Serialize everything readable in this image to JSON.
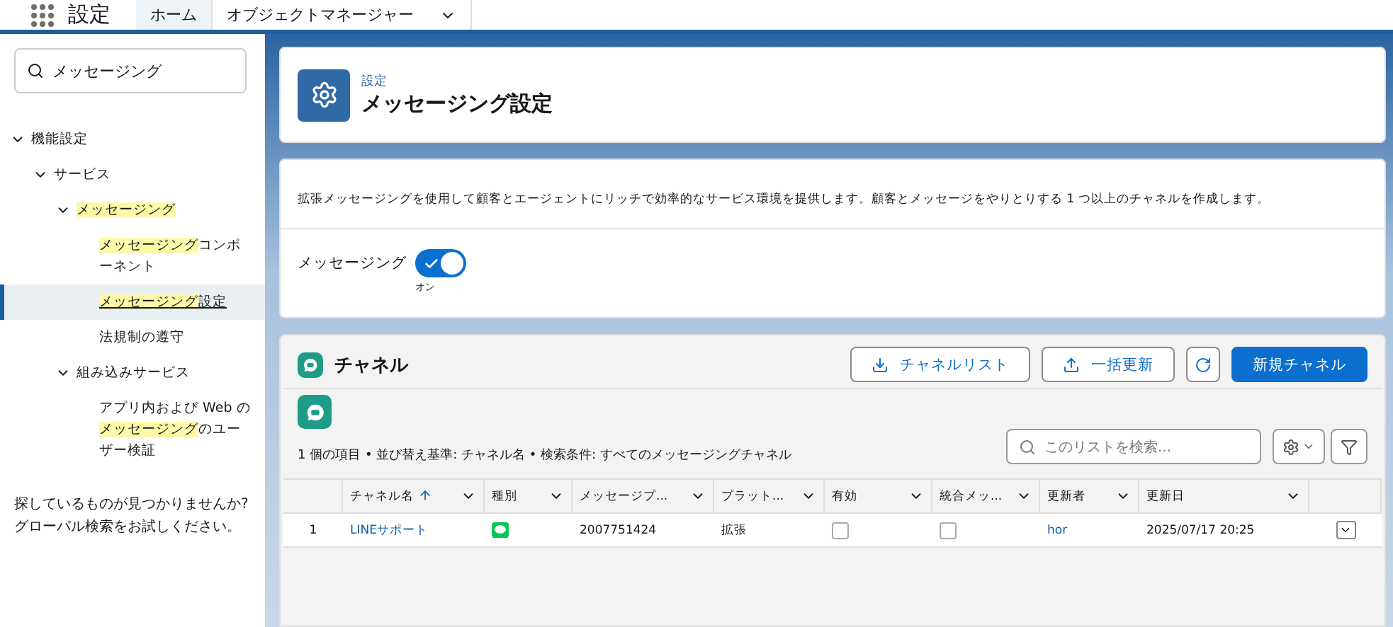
{
  "top_bar": {
    "app_title": "設定",
    "tabs": [
      {
        "label": "ホーム",
        "selected": true,
        "dropdown": false
      },
      {
        "label": "オブジェクトマネージャー",
        "selected": false,
        "dropdown": true
      }
    ]
  },
  "sidebar": {
    "search": {
      "value": "メッセージング"
    },
    "tree": [
      {
        "segments": [
          {
            "text": "機能設定",
            "highlight": false
          }
        ],
        "expanded": true,
        "selected": false,
        "children": [
          {
            "segments": [
              {
                "text": "サービス",
                "highlight": false
              }
            ],
            "expanded": true,
            "selected": false,
            "children": [
              {
                "segments": [
                  {
                    "text": "メッセージング",
                    "highlight": true
                  }
                ],
                "expanded": true,
                "selected": false,
                "children": [
                  {
                    "segments": [
                      {
                        "text": "メッセージング",
                        "highlight": true
                      },
                      {
                        "text": "コンポーネント",
                        "highlight": false
                      }
                    ],
                    "selected": false
                  },
                  {
                    "segments": [
                      {
                        "text": "メッセージング",
                        "highlight": true
                      },
                      {
                        "text": "設定",
                        "highlight": false
                      }
                    ],
                    "selected": true
                  },
                  {
                    "segments": [
                      {
                        "text": "法規制の遵守",
                        "highlight": false
                      }
                    ],
                    "selected": false
                  }
                ]
              },
              {
                "segments": [
                  {
                    "text": "組み込みサービス",
                    "highlight": false
                  }
                ],
                "expanded": true,
                "selected": false,
                "children": [
                  {
                    "segments": [
                      {
                        "text": "アプリ内および Web の",
                        "highlight": false
                      },
                      {
                        "text": "メッセージング",
                        "highlight": true
                      },
                      {
                        "text": "のユーザー検証",
                        "highlight": false
                      }
                    ],
                    "selected": false
                  }
                ]
              }
            ]
          }
        ]
      }
    ],
    "help_text": "探しているものが見つかりませんか? グローバル検索をお試しください。"
  },
  "header": {
    "breadcrumb": "設定",
    "title": "メッセージング設定"
  },
  "settings": {
    "description": "拡張メッセージングを使用して顧客とエージェントにリッチで効率的なサービス環境を提供します。顧客とメッセージをやりとりする 1 つ以上のチャネルを作成します。",
    "toggle": {
      "label": "メッセージング",
      "on": true,
      "state_text": "オン"
    }
  },
  "channels": {
    "title": "チャネル",
    "buttons": [
      {
        "label": "チャネルリスト",
        "kind": "download"
      },
      {
        "label": "一括更新",
        "kind": "upload"
      },
      {
        "kind": "refresh"
      },
      {
        "label": "新規チャネル",
        "kind": "primary"
      }
    ],
    "summary": "1 個の項目 • 並び替え基準: チャネル名 • 検索条件: すべてのメッセージングチャネル",
    "search": {
      "placeholder": "このリストを検索..."
    },
    "table": {
      "columns": [
        {
          "label": "チャネル名",
          "sorted": true
        },
        {
          "label": "種別",
          "sorted": false
        },
        {
          "label": "メッセージプ...",
          "sorted": false
        },
        {
          "label": "プラット...",
          "sorted": false
        },
        {
          "label": "有効",
          "sorted": false
        },
        {
          "label": "統合メッ...",
          "sorted": false
        },
        {
          "label": "更新者",
          "sorted": false
        },
        {
          "label": "更新日",
          "sorted": false
        }
      ],
      "rows": [
        {
          "number": "1",
          "name": "LINEサポート",
          "message_id": "2007751424",
          "platform": "拡張",
          "enabled": false,
          "integrated": false,
          "updated_by": "hor",
          "updated_at": "2025/07/17 20:25"
        }
      ]
    }
  }
}
